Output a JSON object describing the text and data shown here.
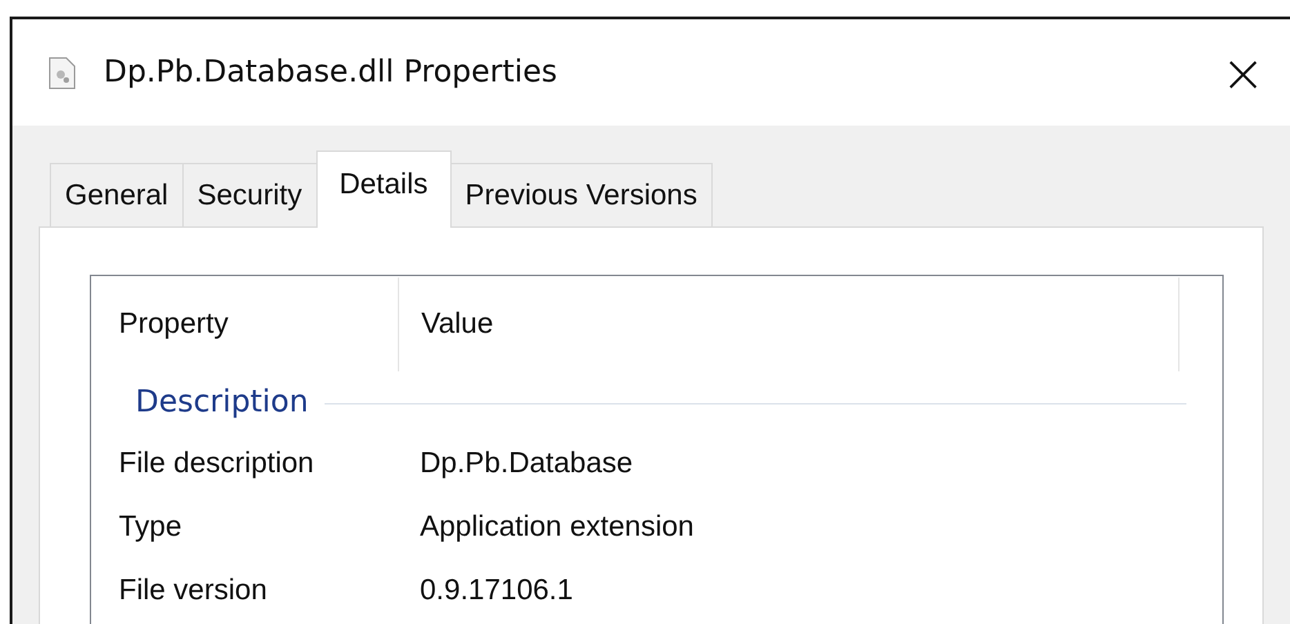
{
  "window": {
    "title": "Dp.Pb.Database.dll Properties",
    "close": "×"
  },
  "tabs": [
    {
      "label": "General",
      "selected": false
    },
    {
      "label": "Security",
      "selected": false
    },
    {
      "label": "Details",
      "selected": true
    },
    {
      "label": "Previous Versions",
      "selected": false
    }
  ],
  "table": {
    "columns": [
      "Property",
      "Value"
    ],
    "groups": [
      {
        "title": "Description",
        "rows": [
          {
            "property": "File description",
            "value": "Dp.Pb.Database"
          },
          {
            "property": "Type",
            "value": "Application extension"
          },
          {
            "property": "File version",
            "value": "0.9.17106.1"
          }
        ]
      }
    ]
  }
}
